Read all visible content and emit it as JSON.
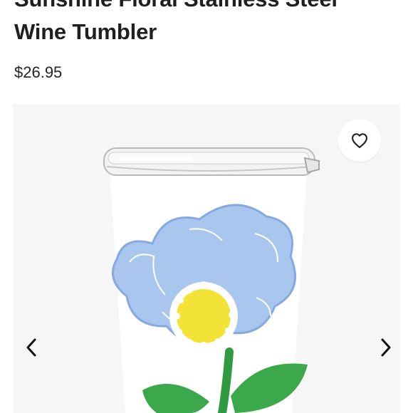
{
  "product": {
    "title_line1": "Sunshine Floral Stainless Steel",
    "title_line2": "Wine Tumbler",
    "price": "$26.95"
  },
  "gallery": {
    "image_subject": "white stainless steel wine tumbler with clear lid and blue flower design",
    "icons": {
      "favorite": "heart-outline-icon",
      "previous": "chevron-left-icon",
      "next": "chevron-right-icon"
    }
  },
  "colors": {
    "text": "#1f1f1f",
    "image_background": "#f6f6f6",
    "tumbler": "#ffffff",
    "flower_petals": "#a9c6ef",
    "flower_outline": "#7ea3dd",
    "flower_center": "#f3e336",
    "leaves": "#3aa84b"
  }
}
